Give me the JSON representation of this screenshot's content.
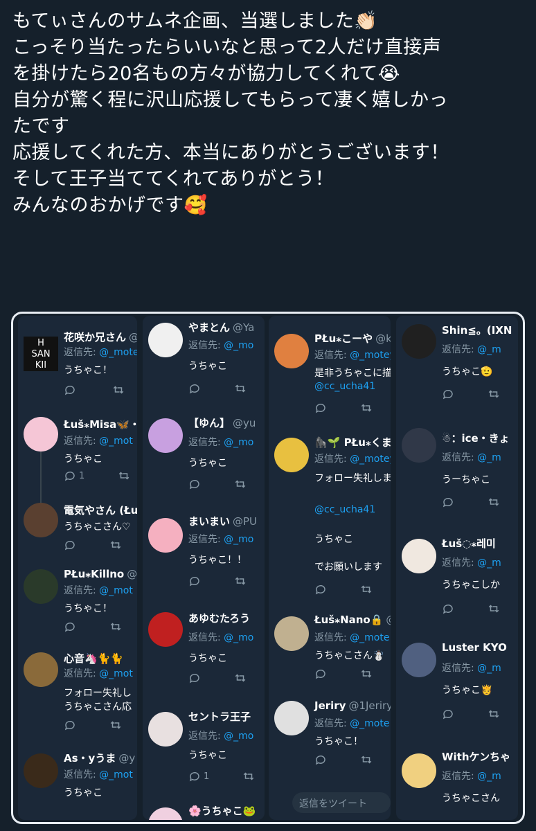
{
  "tweet": {
    "lines": [
      "もてぃさんのサムネ企画、当選しました👏🏻",
      "こっそり当たったらいいなと思って2人だけ直接声",
      "を掛けたら20名もの方々が協力してくれて😭",
      "自分が驚く程に沢山応援してもらって凄く嬉しかっ",
      "たです",
      "応援してくれた方、本当にありがとうございます！",
      "そして王子当ててくれてありがとう！",
      "みんなのおかげです🥰"
    ]
  },
  "reply_prefix": "返信先:",
  "columns": [
    {
      "bg": "#1b2838",
      "replies": [
        {
          "name": "花咲か兄さん",
          "handle": "@",
          "reply_to": "@_mote",
          "body": "うちゃこ！",
          "replies_count": "",
          "avatar_bg": "#111111"
        },
        {
          "name": "Łuš⁎Misa🦋・",
          "handle": "",
          "reply_to": "@_mot",
          "body": "うちゃこ",
          "replies_count": "1",
          "avatar_bg": "#f5c6d6"
        },
        {
          "name": "電気やさん (Łuš",
          "handle": "",
          "reply_to": "",
          "body": "うちゃこさん♡",
          "replies_count": "",
          "avatar_bg": "#5a4030"
        },
        {
          "name": "PŁu⁎Killno",
          "handle": "@k",
          "reply_to": "@_mot",
          "body": "うちゃこ！",
          "replies_count": "",
          "avatar_bg": "#2a3a2a"
        },
        {
          "name": "心音🦄🐈🐈",
          "handle": "",
          "reply_to": "@_mot",
          "body": "フォロー失礼し",
          "body2": "うちゃこさん応",
          "replies_count": "",
          "avatar_bg": "#8a6a3a"
        },
        {
          "name": "As・yうま",
          "handle": "@y",
          "reply_to": "@_mot",
          "body": "うちゃこ",
          "replies_count": "",
          "avatar_bg": "#3a2a1a"
        }
      ]
    },
    {
      "replies": [
        {
          "name": "やまとん",
          "handle": "@Ya",
          "reply_to": "@_mo",
          "body": "うちゃこ",
          "replies_count": "",
          "avatar_bg": "#f0f0f0"
        },
        {
          "name": "【ゆん】",
          "handle": "@yu",
          "reply_to": "@_mo",
          "body": "うちゃこ",
          "replies_count": "",
          "avatar_bg": "#c8a0e0"
        },
        {
          "name": "まいまい",
          "handle": "@PU",
          "reply_to": "@_mo",
          "body": "うちゃこ！！",
          "replies_count": "",
          "avatar_bg": "#f5b0c0"
        },
        {
          "name": "あゆむたろう",
          "handle": "",
          "reply_to": "@_mo",
          "body": "うちゃこ",
          "replies_count": "",
          "avatar_bg": "#c02020"
        },
        {
          "name": "セントラ王子",
          "handle": "",
          "reply_to": "@_mo",
          "body": "うちゃこ",
          "replies_count": "1",
          "avatar_bg": "#e8e0e0"
        },
        {
          "name": "🌸うちゃこ🐸",
          "handle": "",
          "reply_to": "",
          "body": "",
          "replies_count": "",
          "avatar_bg": "#f0d0e0"
        }
      ]
    },
    {
      "replies": [
        {
          "name": "PŁu⁎こーや",
          "handle": "@ko",
          "reply_to": "@_motey",
          "body": "是非うちゃこに描",
          "body2": "@cc_ucha41",
          "replies_count": "",
          "avatar_bg": "#e08040"
        },
        {
          "name": "🦍🌱 PŁu⁎くま",
          "handle": "",
          "reply_to": "@_motey",
          "body": "フォロー失礼しま",
          "body2": "@cc_ucha41",
          "body3": "うちゃこ",
          "body4": "でお願いします",
          "replies_count": "",
          "avatar_bg": "#e8c040"
        },
        {
          "name": "Łuš⁎Nano🔒",
          "handle": "@",
          "reply_to": "@_mote",
          "body": "うちゃこさん☃️",
          "replies_count": "",
          "avatar_bg": "#c0b090"
        },
        {
          "name": "Jeriry",
          "handle": "@1Jeriry",
          "reply_to": "@_mote",
          "body": "うちゃこ！",
          "replies_count": "",
          "avatar_bg": "#e0e0e0"
        }
      ],
      "reply_placeholder": "返信をツイート"
    },
    {
      "replies": [
        {
          "name": "Shin≦。(IXN",
          "handle": "",
          "reply_to": "@_m",
          "body": "うちゃこ🫡",
          "replies_count": "",
          "avatar_bg": "#202020"
        },
        {
          "name": "☃：ice・きょ",
          "handle": "",
          "reply_to": "@_m",
          "body": "うーちゃこ",
          "replies_count": "",
          "avatar_bg": "#303848"
        },
        {
          "name": "Łuš◌⁎레미",
          "handle": "",
          "reply_to": "@_m",
          "body": "うちゃこしか",
          "replies_count": "",
          "avatar_bg": "#f0e8e0"
        },
        {
          "name": "Luster KYO",
          "handle": "",
          "reply_to": "@_m",
          "body": "うちゃこ🫅",
          "replies_count": "",
          "avatar_bg": "#506080"
        },
        {
          "name": "Withケンちゃ",
          "handle": "",
          "reply_to": "@_m",
          "body": "うちゃこさん",
          "replies_count": "",
          "avatar_bg": "#f0d080"
        }
      ]
    }
  ]
}
